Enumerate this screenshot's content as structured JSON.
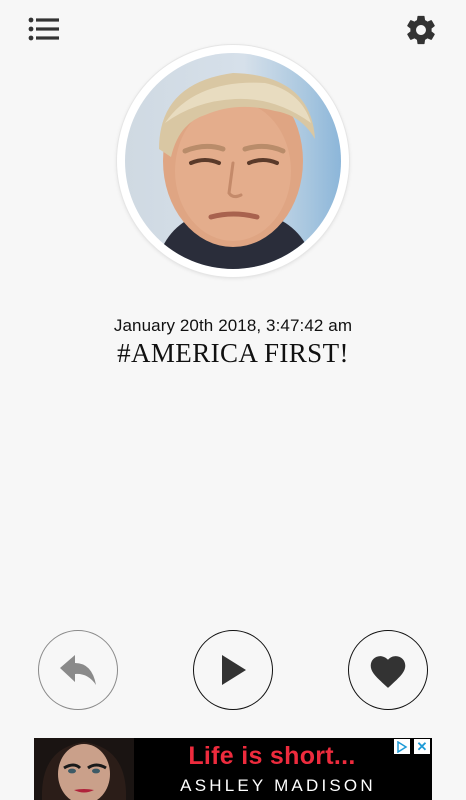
{
  "header": {
    "menu_icon": "list-menu-icon",
    "settings_icon": "gear-icon"
  },
  "profile": {
    "avatar_description": "portrait-photo"
  },
  "post": {
    "timestamp": "January 20th 2018, 3:47:42 am",
    "text": "#AMERICA FIRST!"
  },
  "controls": {
    "reply_icon": "reply-icon",
    "play_icon": "play-icon",
    "like_icon": "heart-icon"
  },
  "ad": {
    "headline": "Life is short...",
    "brand": "ASHLEY MADISON",
    "choices_icon": "adchoices-icon",
    "close_label": "✕"
  },
  "colors": {
    "background": "#f7f7f7",
    "icon_dark": "#333333",
    "reply_gray": "#8a8a8a",
    "ad_red": "#ee2b3d",
    "ad_blue": "#1e9bd7"
  }
}
